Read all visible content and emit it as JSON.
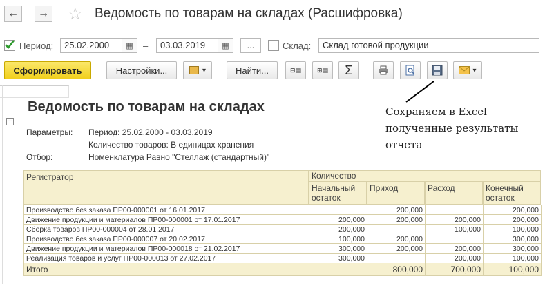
{
  "window": {
    "title": "Ведомость по товарам на складах (Расшифровка)",
    "back_icon": "←",
    "forward_icon": "→",
    "star_icon": "☆"
  },
  "filters": {
    "period_label": "Период:",
    "date_from": "25.02.2000",
    "dash": "–",
    "date_to": "03.03.2019",
    "ellipsis": "...",
    "warehouse_label": "Склад:",
    "warehouse_value": "Склад готовой продукции"
  },
  "toolbar": {
    "generate": "Сформировать",
    "settings": "Настройки...",
    "find": "Найти...",
    "sum_icon": "Σ",
    "dropdown_icon": "▾"
  },
  "report": {
    "title": "Ведомость по товарам на складах",
    "params_label": "Параметры:",
    "params_line1": "Период: 25.02.2000 - 03.03.2019",
    "params_line2": "Количество товаров: В единицах хранения",
    "filter_label": "Отбор:",
    "filter_value": "Номенклатура Равно \"Стеллаж (стандартный)\"",
    "header": {
      "registrar": "Регистратор",
      "quantity": "Количество",
      "opening_1": "Начальный",
      "opening_2": "остаток",
      "income": "Приход",
      "expense": "Расход",
      "closing_1": "Конечный",
      "closing_2": "остаток"
    },
    "rows": [
      {
        "reg": "Производство без заказа ПР00-000001 от 16.01.2017",
        "open": "",
        "inc": "200,000",
        "exp": "",
        "close": "200,000"
      },
      {
        "reg": "Движение продукции и материалов ПР00-000001 от 17.01.2017",
        "open": "200,000",
        "inc": "200,000",
        "exp": "200,000",
        "close": "200,000"
      },
      {
        "reg": "Сборка товаров ПР00-000004 от 28.01.2017",
        "open": "200,000",
        "inc": "",
        "exp": "100,000",
        "close": "100,000"
      },
      {
        "reg": "Производство без заказа ПР00-000007 от 20.02.2017",
        "open": "100,000",
        "inc": "200,000",
        "exp": "",
        "close": "300,000"
      },
      {
        "reg": "Движение продукции и материалов ПР00-000018 от 21.02.2017",
        "open": "300,000",
        "inc": "200,000",
        "exp": "200,000",
        "close": "300,000"
      },
      {
        "reg": "Реализация товаров и услуг ПР00-000013 от 27.02.2017",
        "open": "300,000",
        "inc": "",
        "exp": "200,000",
        "close": "100,000"
      }
    ],
    "total": {
      "label": "Итого",
      "open": "",
      "inc": "800,000",
      "exp": "700,000",
      "close": "100,000"
    },
    "collapse_icon": "−"
  },
  "annotation": {
    "line1": "Сохраняем в Excel",
    "line2": "полученные результаты",
    "line3": "отчета"
  }
}
